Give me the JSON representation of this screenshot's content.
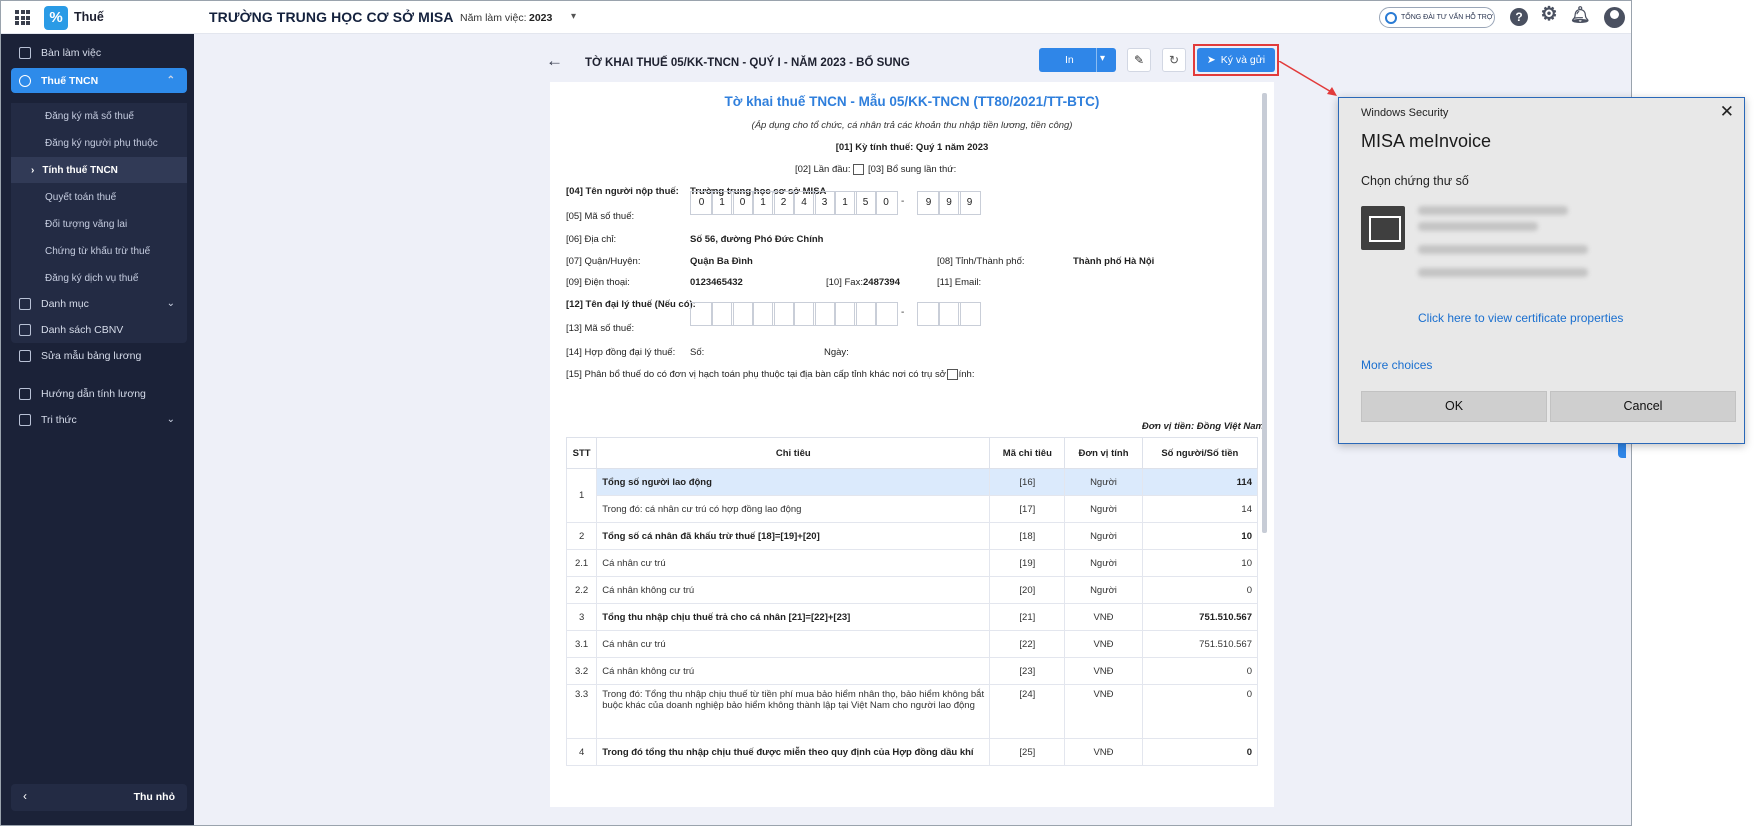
{
  "topbar": {
    "brand": "Thuế",
    "school": "TRƯỜNG TRUNG HỌC CƠ SỞ MISA",
    "year_label": "Năm làm việc:",
    "year_value": "2023",
    "support": "TỔNG ĐÀI TƯ VẤN HỖ TRỢ"
  },
  "sidebar": {
    "items": [
      {
        "label": "Bàn làm việc"
      },
      {
        "label": "Thuế TNCN"
      },
      {
        "label": "Danh mục"
      },
      {
        "label": "Danh sách CBNV"
      },
      {
        "label": "Sửa mẫu bảng lương"
      },
      {
        "label": "Hướng dẫn tính lương"
      },
      {
        "label": "Tri thức"
      }
    ],
    "sub_items": [
      {
        "label": "Đăng ký mã số thuế"
      },
      {
        "label": "Đăng ký người phụ thuộc"
      },
      {
        "label": "Tính thuế TNCN"
      },
      {
        "label": "Quyết toán thuế"
      },
      {
        "label": "Đối tượng vãng lai"
      },
      {
        "label": "Chứng từ khấu trừ thuế"
      },
      {
        "label": "Đăng ký dịch vụ thuế"
      }
    ],
    "collapse": "Thu nhỏ"
  },
  "header": {
    "title": "TỜ KHAI THUẾ 05/KK-TNCN - QUÝ I - NĂM 2023 - BỔ SUNG",
    "print": "In",
    "sign": "Ký và gửi"
  },
  "form": {
    "title": "Tờ khai thuế TNCN - Mẫu 05/KK-TNCN (TT80/2021/TT-BTC)",
    "subtitle": "(Áp dụng cho tổ chức, cá nhân trả các khoản thu nhập tiền lương, tiền công)",
    "period": "[01] Kỳ tính thuế: Quý 1 năm 2023",
    "first_label": "[02] Lần đầu:",
    "supp_label": "[03] Bổ sung lần thứ:",
    "f04_label": "[04] Tên người nộp thuế:",
    "f04_value": "Trường trung học cơ sở MISA",
    "f05_label": "[05] Mã số thuế:",
    "tax_digits": [
      "0",
      "1",
      "0",
      "1",
      "2",
      "4",
      "3",
      "1",
      "5",
      "0"
    ],
    "tax_suffix": [
      "9",
      "9",
      "9"
    ],
    "f06_label": "[06] Địa chỉ:",
    "f06_value": "Số 56, đường Phó Đức Chính",
    "f07_label": "[07] Quận/Huyện:",
    "f07_value": "Quận Ba Đình",
    "f08_label": "[08] Tỉnh/Thành phố:",
    "f08_value": "Thành phố Hà Nội",
    "f09_label": "[09] Điện thoại:",
    "f09_value": "0123465432",
    "f10_label": "[10] Fax:",
    "f10_value": "2487394",
    "f11_label": "[11] Email:",
    "f12_label": "[12] Tên đại lý thuế (Nếu có):",
    "f13_label": "[13] Mã số thuế:",
    "f14_label": "[14] Hợp đồng đại lý thuế:",
    "f14_no": "Số:",
    "f14_date": "Ngày:",
    "f15_label": "[15] Phân bổ thuế do có đơn vị hạch toán phụ thuộc tại địa bàn cấp tỉnh khác nơi có trụ sở chính:",
    "currency": "Đơn vị tiền: Đồng Việt Nam"
  },
  "table": {
    "headers": [
      "STT",
      "Chỉ tiêu",
      "Mã chỉ tiêu",
      "Đơn vị tính",
      "Số người/Số tiền"
    ],
    "rows": [
      {
        "stt": "1",
        "label": "Tổng số người lao động",
        "code": "[16]",
        "unit": "Người",
        "value": "114"
      },
      {
        "stt": "",
        "label": "Trong đó: cá nhân cư trú có hợp đồng lao động",
        "code": "[17]",
        "unit": "Người",
        "value": "14"
      },
      {
        "stt": "2",
        "label": "Tổng số cá nhân đã khấu trừ thuế [18]=[19]+[20]",
        "code": "[18]",
        "unit": "Người",
        "value": "10"
      },
      {
        "stt": "2.1",
        "label": "Cá nhân cư trú",
        "code": "[19]",
        "unit": "Người",
        "value": "10"
      },
      {
        "stt": "2.2",
        "label": "Cá nhân không cư trú",
        "code": "[20]",
        "unit": "Người",
        "value": "0"
      },
      {
        "stt": "3",
        "label": "Tổng thu nhập chịu thuế trả cho cá nhân [21]=[22]+[23]",
        "code": "[21]",
        "unit": "VNĐ",
        "value": "751.510.567"
      },
      {
        "stt": "3.1",
        "label": "Cá nhân cư trú",
        "code": "[22]",
        "unit": "VNĐ",
        "value": "751.510.567"
      },
      {
        "stt": "3.2",
        "label": "Cá nhân không cư trú",
        "code": "[23]",
        "unit": "VNĐ",
        "value": "0"
      },
      {
        "stt": "3.3",
        "label": "Trong đó: Tổng thu nhập chịu thuế từ tiền phí mua bảo hiểm nhân thọ, bảo hiểm không bắt buộc khác của doanh nghiệp bảo hiểm không thành lập tại Việt Nam cho người lao động",
        "code": "[24]",
        "unit": "VNĐ",
        "value": "0"
      },
      {
        "stt": "4",
        "label": "Trong đó tổng thu nhập chịu thuế được miễn theo quy định của Hợp đồng dầu khí",
        "code": "[25]",
        "unit": "VNĐ",
        "value": "0"
      }
    ]
  },
  "dialog": {
    "header": "Windows Security",
    "app": "MISA meInvoice",
    "prompt": "Chọn chứng thư số",
    "link": "Click here to view certificate properties",
    "more": "More choices",
    "ok": "OK",
    "cancel": "Cancel"
  },
  "colors": {
    "accent": "#2f86e8",
    "sidebar": "#1b2238",
    "highlight": "#e23b3b"
  }
}
